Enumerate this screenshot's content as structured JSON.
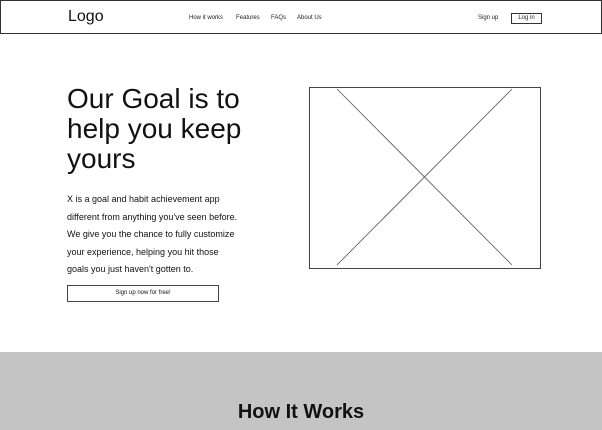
{
  "header": {
    "logo": "Logo",
    "nav": [
      "How it works",
      "Features",
      "FAQs",
      "About Us"
    ],
    "signup": "Sign up",
    "login": "Log in"
  },
  "hero": {
    "heading_lines": [
      "Our Goal is to",
      "help you keep",
      "yours"
    ],
    "description_lines": [
      "X is a goal and habit achievement app",
      "different from anything you've seen before.",
      "We give you the chance  to fully customize",
      "your experience, helping you hit those",
      "goals you just haven't gotten to."
    ],
    "cta": "Sign up now for free!",
    "image_icon": "image-placeholder-icon"
  },
  "how_it_works": {
    "title": "How It Works",
    "background": "#c4c4c4"
  }
}
